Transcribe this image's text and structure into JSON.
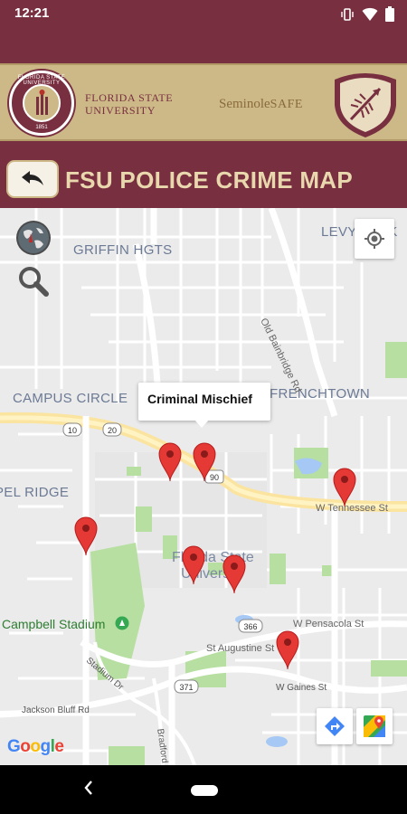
{
  "status_bar": {
    "time": "12:21",
    "icons": [
      "vibrate-icon",
      "wifi-icon",
      "battery-icon"
    ]
  },
  "banner": {
    "university_line1": "FLORIDA STATE",
    "university_line2": "UNIVERSITY",
    "seal_ring_text": "FLORIDA STATE UNIVERSITY",
    "seal_year": "1851",
    "app_brand_part1": "Seminole",
    "app_brand_part2": "SAFE"
  },
  "header": {
    "title": "FSU POLICE CRIME MAP",
    "back_icon": "back-arrow-icon"
  },
  "map": {
    "neighborhoods": [
      "GRIFFIN HGTS",
      "LEVY PARK",
      "CAMPUS CIRCLE",
      "FRENCHTOWN",
      "PEL RIDGE"
    ],
    "campus_line1": "Florida State",
    "campus_line2": "University",
    "stadium": "Campbell Stadium",
    "roads": {
      "old_bainbridge": "Old Bainbridge Rd",
      "w_tennessee": "W Tennessee St",
      "w_pensacola": "W Pensacola St",
      "st_augustine": "St Augustine St",
      "w_gaines": "W Gaines St",
      "stadium_dr": "Stadium Dr",
      "jackson_bluff": "Jackson Bluff Rd",
      "bradford": "Bradford Rd"
    },
    "route_shields": [
      "10",
      "20",
      "90",
      "366",
      "371"
    ],
    "info_window_text": "Criminal Mischief",
    "marker_count": 8,
    "attribution": "Google",
    "colors": {
      "marker": "#e53935",
      "primary": "#782f40",
      "gold": "#cdb887",
      "highway": "#fce8a4",
      "park": "#b7dfa2",
      "water": "#a6c8f5"
    }
  },
  "controls": {
    "globe_icon": "globe-icon",
    "zoom_icon": "magnifier-icon",
    "locate_icon": "my-location-icon",
    "directions_icon": "directions-icon",
    "maps_icon": "google-maps-icon"
  }
}
